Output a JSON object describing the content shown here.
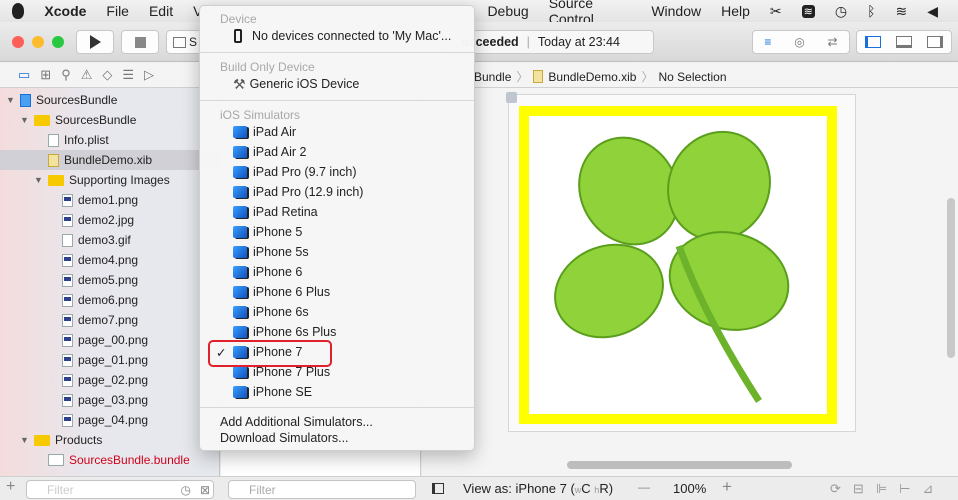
{
  "menubar": {
    "apple": "",
    "app": "Xcode",
    "items": [
      "File",
      "Edit",
      "V",
      "Debug",
      "Source Control",
      "Window",
      "Help"
    ]
  },
  "toolbar": {
    "scheme_partial": "S",
    "status_bold": "ucceeded",
    "status_time": "Today at 23:44"
  },
  "jump_bar": {
    "items": [
      "Bundle",
      "BundleDemo.xib",
      "No Selection"
    ]
  },
  "navigator": {
    "rows": [
      {
        "label": "SourcesBundle",
        "kind": "project",
        "indent": 0,
        "open": true
      },
      {
        "label": "SourcesBundle",
        "kind": "folder",
        "indent": 1,
        "open": true
      },
      {
        "label": "Info.plist",
        "kind": "file",
        "indent": 2
      },
      {
        "label": "BundleDemo.xib",
        "kind": "xib",
        "indent": 2,
        "selected": true
      },
      {
        "label": "Supporting Images",
        "kind": "folder",
        "indent": 2,
        "open": true
      },
      {
        "label": "demo1.png",
        "kind": "img",
        "indent": 3
      },
      {
        "label": "demo2.jpg",
        "kind": "img",
        "indent": 3
      },
      {
        "label": "demo3.gif",
        "kind": "file",
        "indent": 3
      },
      {
        "label": "demo4.png",
        "kind": "img",
        "indent": 3
      },
      {
        "label": "demo5.png",
        "kind": "img",
        "indent": 3
      },
      {
        "label": "demo6.png",
        "kind": "img",
        "indent": 3
      },
      {
        "label": "demo7.png",
        "kind": "img",
        "indent": 3
      },
      {
        "label": "page_00.png",
        "kind": "img",
        "indent": 3
      },
      {
        "label": "page_01.png",
        "kind": "img",
        "indent": 3
      },
      {
        "label": "page_02.png",
        "kind": "img",
        "indent": 3
      },
      {
        "label": "page_03.png",
        "kind": "img",
        "indent": 3
      },
      {
        "label": "page_04.png",
        "kind": "img",
        "indent": 3
      },
      {
        "label": "Products",
        "kind": "folder",
        "indent": 1,
        "open": true
      },
      {
        "label": "SourcesBundle.bundle",
        "kind": "bundle",
        "indent": 2,
        "red": true
      }
    ],
    "filter_placeholder": "Filter"
  },
  "outline": {
    "filter_placeholder": "Filter"
  },
  "device_menu": {
    "device_header": "Device",
    "no_devices": "No devices connected to 'My Mac'...",
    "build_only_header": "Build Only Device",
    "generic": "Generic iOS Device",
    "simulators_header": "iOS Simulators",
    "simulators": [
      "iPad Air",
      "iPad Air 2",
      "iPad Pro (9.7 inch)",
      "iPad Pro (12.9 inch)",
      "iPad Retina",
      "iPhone 5",
      "iPhone 5s",
      "iPhone 6",
      "iPhone 6 Plus",
      "iPhone 6s",
      "iPhone 6s Plus",
      "iPhone 7",
      "iPhone 7 Plus",
      "iPhone SE"
    ],
    "selected": "iPhone 7",
    "checkmark": "✓",
    "add": "Add Additional Simulators...",
    "download": "Download Simulators..."
  },
  "canvas_bar": {
    "view_as": "View as: iPhone 7 (",
    "w": "w",
    "c": "C",
    "h": "h",
    "r": "R)",
    "minus": "—",
    "zoom": "100%",
    "plus": "+"
  },
  "colors": {
    "highlight": "#e0202c",
    "frame": "#ffff00",
    "accent": "#1a6fd8"
  }
}
